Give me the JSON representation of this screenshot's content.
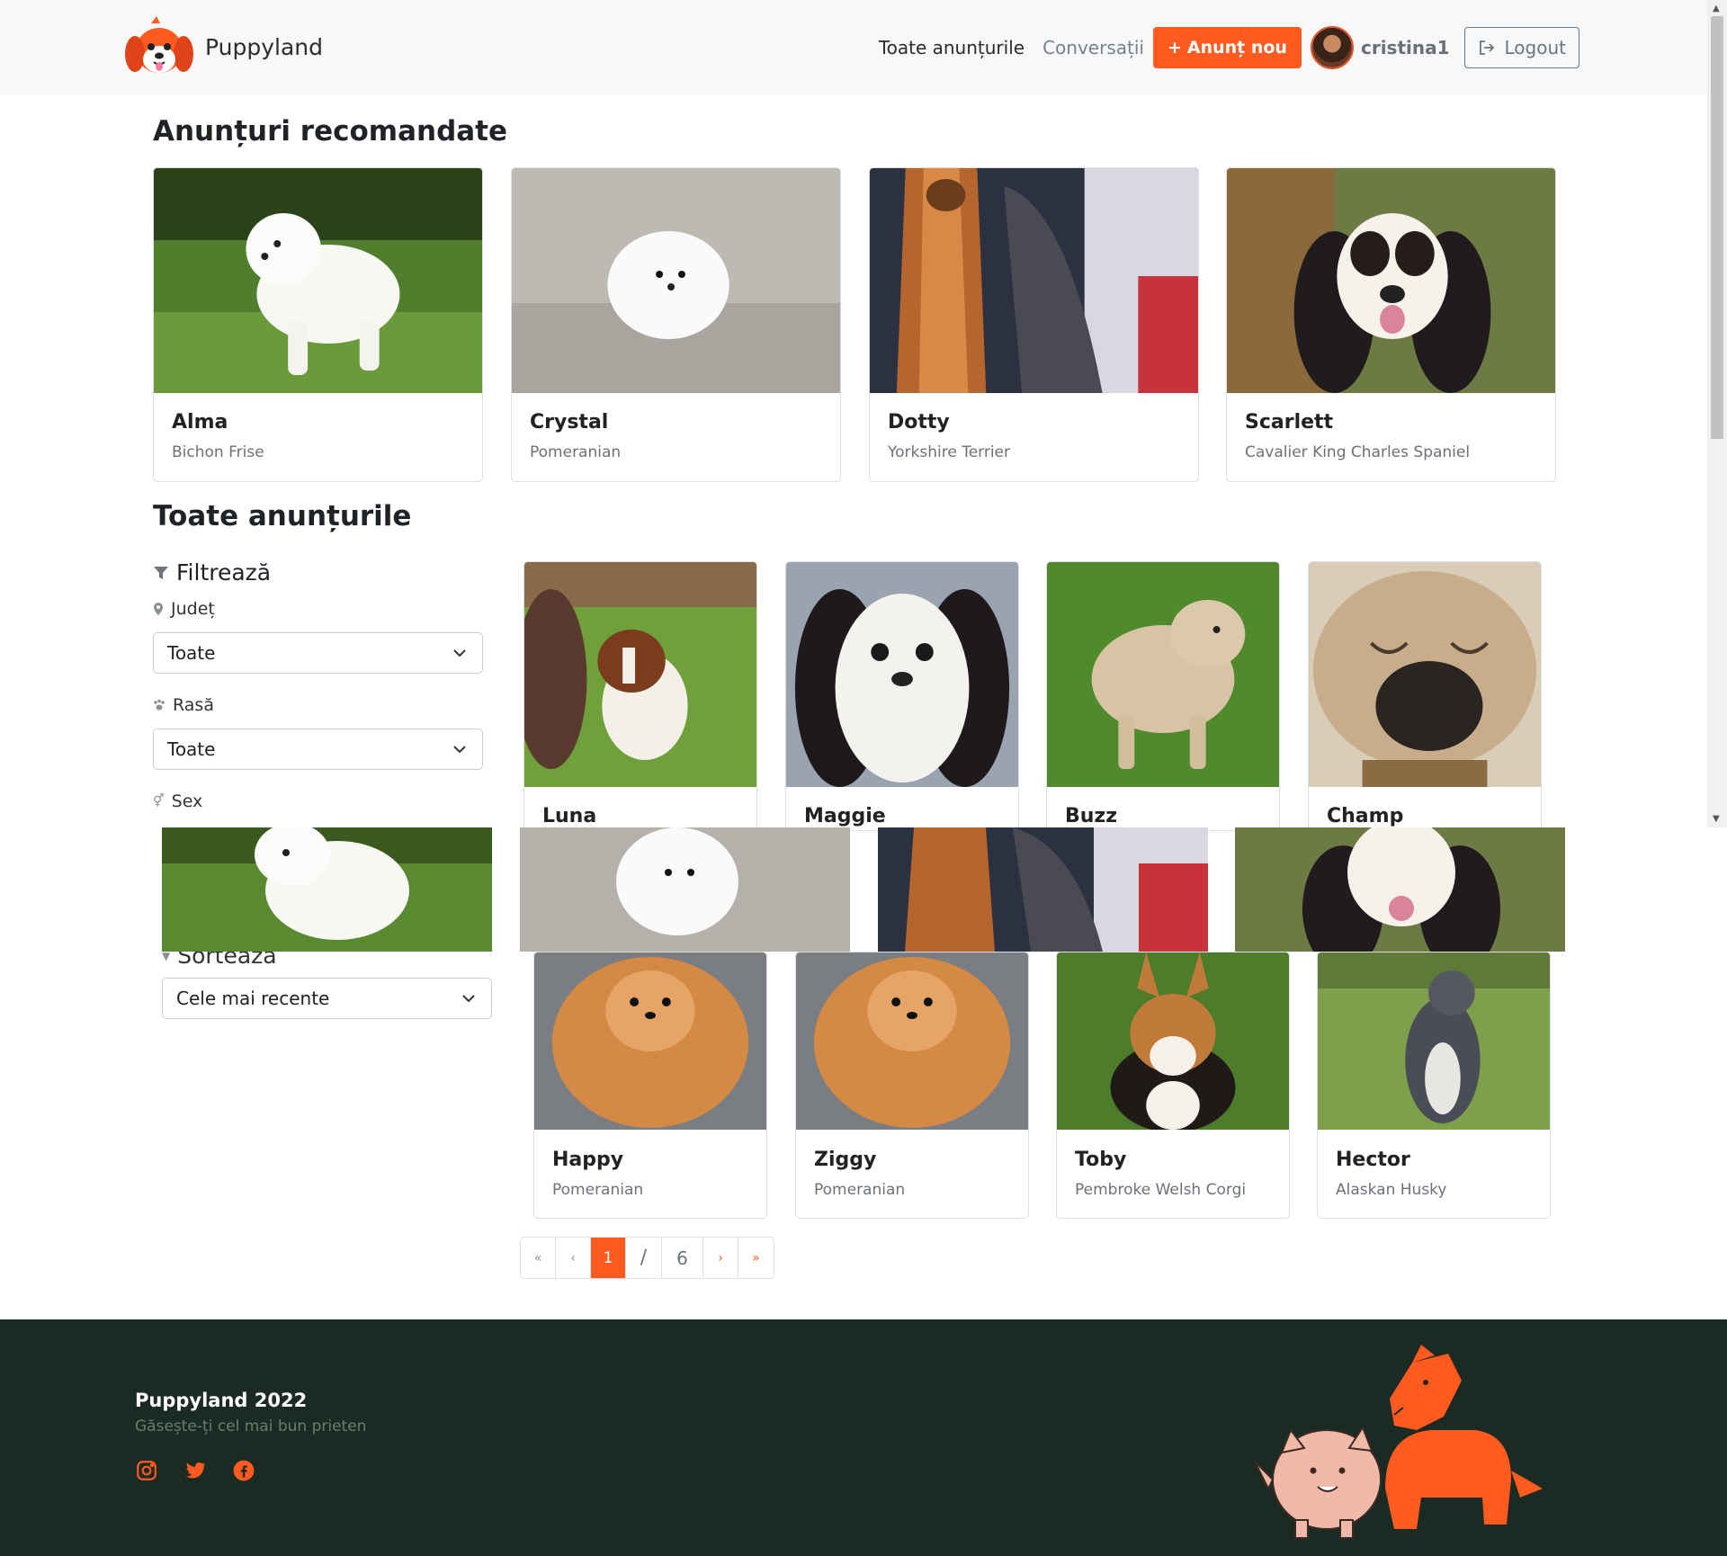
{
  "header": {
    "brand": "Puppyland",
    "nav_all": "Toate anunțurile",
    "nav_chats": "Conversații",
    "new_listing": "Anunț nou",
    "username": "cristina1",
    "logout": "Logout"
  },
  "recommended": {
    "title": "Anunțuri recomandate",
    "cards": [
      {
        "name": "Alma",
        "breed": "Bichon Frise"
      },
      {
        "name": "Crystal",
        "breed": "Pomeranian"
      },
      {
        "name": "Dotty",
        "breed": "Yorkshire Terrier"
      },
      {
        "name": "Scarlett",
        "breed": "Cavalier King Charles Spaniel"
      }
    ]
  },
  "all": {
    "title": "Toate anunțurile",
    "cards_row1": [
      {
        "name": "Luna",
        "breed": ""
      },
      {
        "name": "Maggie",
        "breed": ""
      },
      {
        "name": "Buzz",
        "breed": ""
      },
      {
        "name": "Champ",
        "breed": ""
      }
    ],
    "cards_row2": [
      {
        "name": "Happy",
        "breed": "Pomeranian"
      },
      {
        "name": "Ziggy",
        "breed": "Pomeranian"
      },
      {
        "name": "Toby",
        "breed": "Pembroke Welsh Corgi"
      },
      {
        "name": "Hector",
        "breed": "Alaskan Husky"
      }
    ]
  },
  "filters": {
    "title": "Filtrează",
    "county_label": "Județ",
    "county_value": "Toate",
    "breed_label": "Rasă",
    "breed_value": "Toate",
    "sex_label": "Sex",
    "sort_label": "Sortează",
    "sort_value": "Cele mai recente"
  },
  "pagination": {
    "first": "«",
    "prev": "‹",
    "current": "1",
    "separator": "/",
    "total": "6",
    "next": "›",
    "last": "»"
  },
  "footer": {
    "title": "Puppyland 2022",
    "tagline": "Găsește-ți cel mai bun prieten",
    "socials": [
      "instagram-icon",
      "twitter-icon",
      "facebook-icon"
    ]
  },
  "colors": {
    "accent": "#ff5a1f",
    "footer_bg": "#1b2b23"
  }
}
